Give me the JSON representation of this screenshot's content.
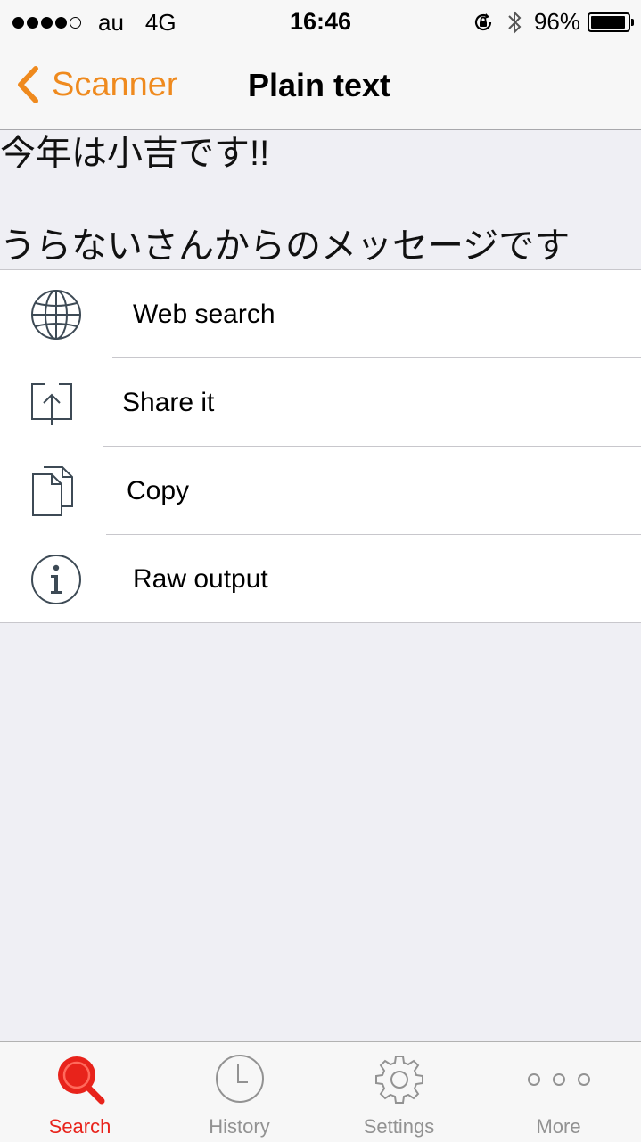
{
  "status_bar": {
    "carrier": "au",
    "network": "4G",
    "time": "16:46",
    "battery_percent_text": "96%",
    "battery_level": 0.96,
    "signal_bars_filled": 4,
    "signal_bars_total": 5
  },
  "nav": {
    "back_label": "Scanner",
    "title": "Plain text"
  },
  "result": {
    "line1": "今年は小吉です!!",
    "line2": "",
    "line3": "うらないさんからのメッセージです"
  },
  "actions": [
    {
      "label": "Web search",
      "icon": "globe-icon"
    },
    {
      "label": "Share it",
      "icon": "share-icon"
    },
    {
      "label": "Copy",
      "icon": "copy-icon"
    },
    {
      "label": "Raw output",
      "icon": "info-icon"
    }
  ],
  "tabs": [
    {
      "label": "Search",
      "icon": "search-icon",
      "active": true
    },
    {
      "label": "History",
      "icon": "clock-icon",
      "active": false
    },
    {
      "label": "Settings",
      "icon": "gear-icon",
      "active": false
    },
    {
      "label": "More",
      "icon": "more-icon",
      "active": false
    }
  ],
  "colors": {
    "accent": "#ef8a1e",
    "active_tab": "#e8231b",
    "inactive_tab": "#929292",
    "icon_stroke": "#3d4a55"
  }
}
